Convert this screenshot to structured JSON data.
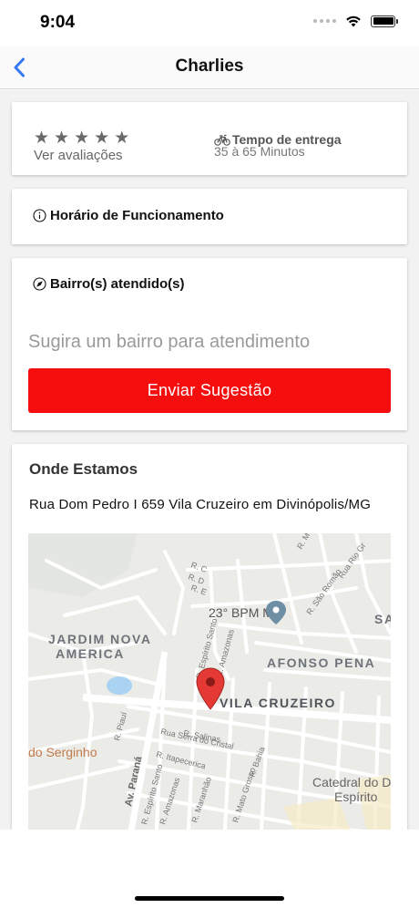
{
  "status_bar": {
    "time": "9:04"
  },
  "nav": {
    "title": "Charlies",
    "back_icon": "chevron-left-icon",
    "accent": "#3478f6"
  },
  "info": {
    "stars": [
      "★",
      "★",
      "★",
      "★",
      "★"
    ],
    "reviews_label": "Ver avaliações",
    "delivery_icon": "bicycle-icon",
    "delivery_title": "Tempo de entrega",
    "delivery_time": "35 à 65 Minutos"
  },
  "hours": {
    "icon": "info-icon",
    "label": "Horário de Funcionamento"
  },
  "neighborhoods": {
    "icon": "navigation-icon",
    "label": "Bairro(s) atendido(s)",
    "input_placeholder": "Sugira um bairro para atendimento",
    "input_value": "",
    "button_label": "Enviar Sugestão",
    "button_color": "#f40e0e"
  },
  "location": {
    "title": "Onde Estamos",
    "address": "Rua Dom Pedro I 659 Vila Cruzeiro em Divinópolis/MG",
    "map": {
      "labels": {
        "district_1_line1": "JARDIM NOVA",
        "district_1_line2": "AMERICA",
        "district_2": "AFONSO PENA",
        "district_3": "VILA CRUZEIRO",
        "district_4": "SA",
        "poi_bpm": "23° BPM MG",
        "poi_serginho": "do Serginho",
        "poi_catedral_line1": "Catedral do D",
        "poi_catedral_line2": "Espírito",
        "street_rc": "R. C",
        "street_rd": "R. D",
        "street_re": "R. E",
        "street_rm": "R. M",
        "street_santo": "R. Espírito Santo",
        "street_amazonas": "R. Amazonas",
        "street_piaui": "R. Piauí",
        "street_salinas": "R. Salinas",
        "street_serra": "Rua Serra do Cristal",
        "street_itapecerica": "R. Itapecerica",
        "street_bahia": "R. Bahia",
        "street_parana": "Av. Paraná",
        "street_santo2": "R. Espírito Santo",
        "street_amazonas2": "R. Amazonas",
        "street_maranhao": "R. Maranhão",
        "street_mato": "R. Mato Grosso",
        "street_saoromao": "R. São Romão",
        "street_riogr": "Rua Rio Gr"
      }
    }
  }
}
